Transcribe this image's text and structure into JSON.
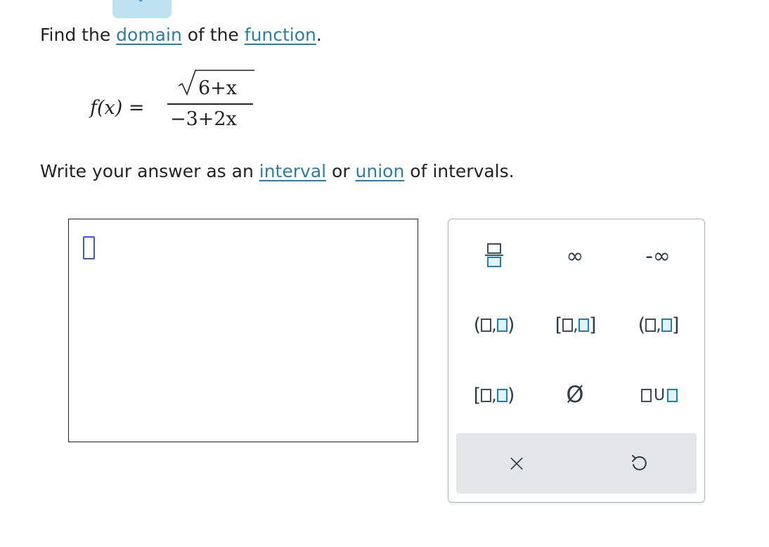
{
  "instruction": {
    "prefix": "Find the ",
    "domain_link": "domain",
    "middle": " of the ",
    "function_link": "function",
    "suffix": "."
  },
  "formula": {
    "lhs": "f(x) =",
    "numerator": "6+x",
    "denominator": "−3+2x"
  },
  "answer_instruction": {
    "prefix": "Write your answer as an ",
    "interval_link": "interval",
    "middle": " or ",
    "union_link": "union",
    "suffix": " of intervals."
  },
  "palette": {
    "infinity": "∞",
    "neg_infinity": "-∞",
    "empty_set": "Ø",
    "clear": "×",
    "union": "U"
  },
  "colors": {
    "link": "#2a7ea6",
    "caret": "#3a55e6",
    "accent_box": "#1c7fbd",
    "tab": "#bfe3f0"
  }
}
